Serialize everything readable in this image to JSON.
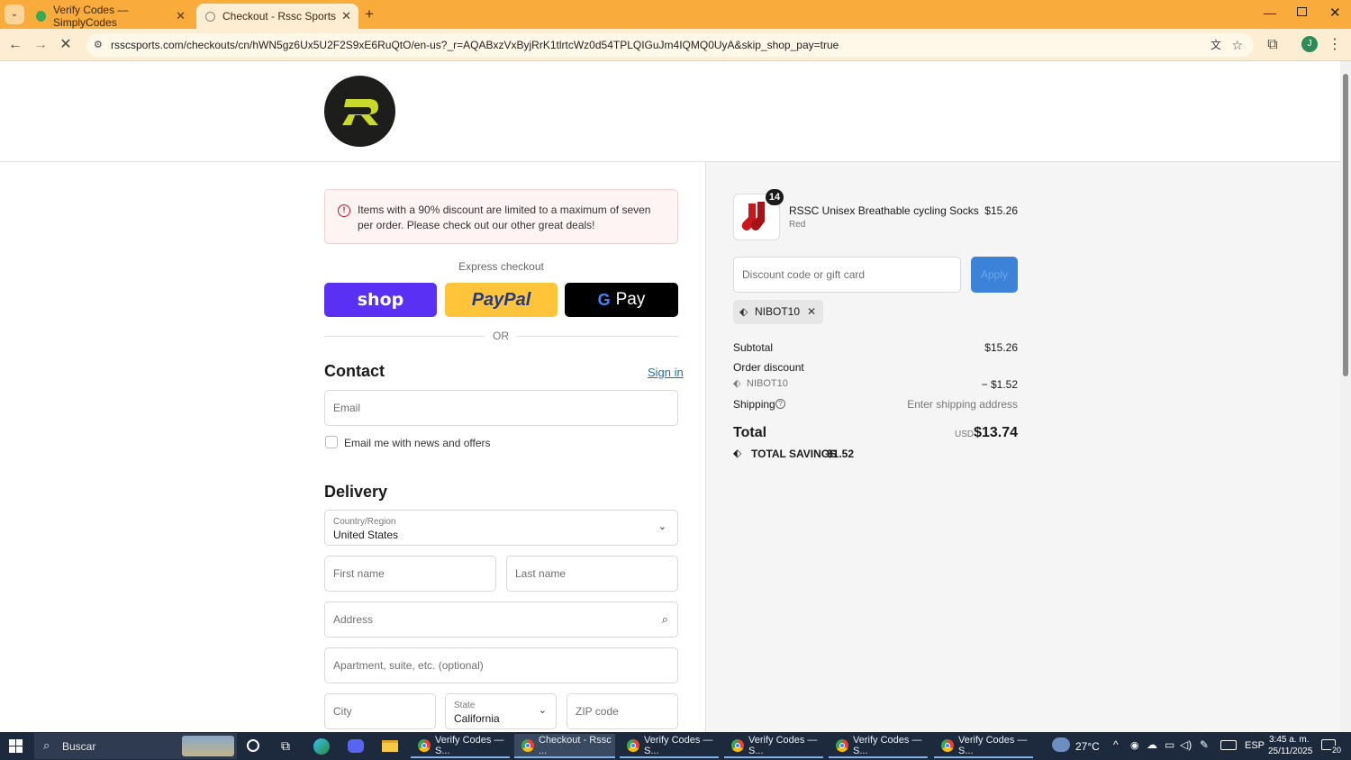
{
  "browser": {
    "tabs": [
      {
        "title": "Verify Codes — SimplyCodes",
        "active": false
      },
      {
        "title": "Checkout - Rssc Sports",
        "active": true
      }
    ],
    "url": "rsscsports.com/checkouts/cn/hWN5gz6Ux5U2F2S9xE6RuQtO/en-us?_r=AQABxzVxByjRrK1tlrtcWz0d54TPLQIGuJm4IQMQ0UyA&skip_shop_pay=true",
    "profile_initial": "J"
  },
  "checkout": {
    "alert": "Items with a 90% discount are limited to a maximum of seven per order. Please check out our other great deals!",
    "express_label": "Express checkout",
    "shop_label": "shop",
    "paypal_label": "PayPal",
    "gpay_label": "Pay",
    "or_label": "OR",
    "contact": {
      "title": "Contact",
      "sign_in": "Sign in",
      "email_placeholder": "Email",
      "news_label": "Email me with news and offers"
    },
    "delivery": {
      "title": "Delivery",
      "country_label": "Country/Region",
      "country_value": "United States",
      "first_name": "First name",
      "last_name": "Last name",
      "address": "Address",
      "apartment": "Apartment, suite, etc. (optional)",
      "city": "City",
      "state_label": "State",
      "state_value": "California",
      "zip": "ZIP code"
    }
  },
  "summary": {
    "item": {
      "qty": "14",
      "name": "RSSC Unisex Breathable cycling Socks",
      "variant": "Red",
      "price": "$15.26"
    },
    "discount_placeholder": "Discount code or gift card",
    "apply_label": "Apply",
    "applied_code": "NIBOT10",
    "subtotal_label": "Subtotal",
    "subtotal_value": "$15.26",
    "order_discount_label": "Order discount",
    "discount_code": "NIBOT10",
    "discount_value": "− $1.52",
    "shipping_label": "Shipping",
    "shipping_value": "Enter shipping address",
    "total_label": "Total",
    "currency": "USD",
    "total_value": "$13.74",
    "savings_label": "TOTAL SAVINGS",
    "savings_value": "$1.52"
  },
  "taskbar": {
    "search": "Buscar",
    "apps": [
      {
        "label": "Verify Codes — S...",
        "active": false
      },
      {
        "label": "Checkout - Rssc ...",
        "active": true
      },
      {
        "label": "Verify Codes — S...",
        "active": false
      },
      {
        "label": "Verify Codes — S...",
        "active": false
      },
      {
        "label": "Verify Codes — S...",
        "active": false
      },
      {
        "label": "Verify Codes — S...",
        "active": false
      }
    ],
    "weather": "27°C",
    "lang": "ESP",
    "time": "3:45 a. m.",
    "date": "25/11/2025",
    "notifications": "20"
  },
  "colors": {
    "accent": "#f9ab3b",
    "link": "#1773b0",
    "apply_button": "#3b82d8",
    "shop_pay": "#5a31f4",
    "paypal": "#ffc439",
    "logo_mark": "#c9d92b"
  }
}
